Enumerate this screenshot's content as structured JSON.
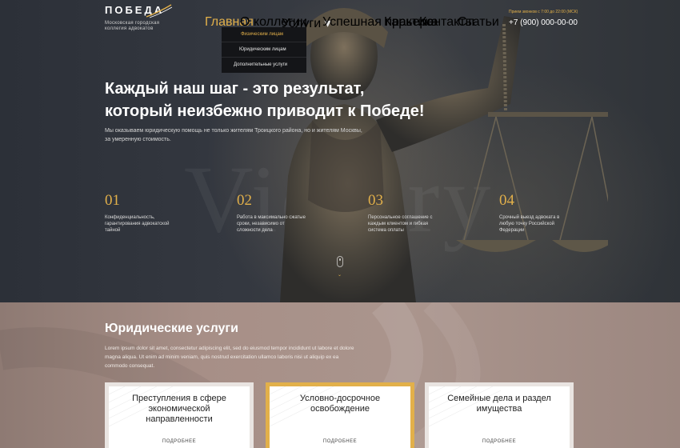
{
  "header": {
    "logo_name": "ПОБЕДА",
    "logo_sub_line1": "Московская городская",
    "logo_sub_line2": "коллегия адвокатов",
    "phone_note": "Прием звонков с 7:00 до 22:00 (МСК)",
    "phone": "+7 (900) 000-00-00",
    "nav": [
      "Главная",
      "О коллегии",
      "Услуги",
      "Успешная практика",
      "Карьера",
      "Контакты",
      "Статьи"
    ],
    "services_chevron": "▾"
  },
  "dropdown": [
    "Физическим лицам",
    "Юридическим лицам",
    "Дополнительные услуги"
  ],
  "hero": {
    "title_line1": "Каждый наш шаг - это результат,",
    "title_line2": "который неизбежно приводит к Победе!",
    "subtitle_line1": "Мы оказываем юридическую помощь не только жителям Троицкого района, но и жителям Москвы,",
    "subtitle_line2": "за умеренную стоимость.",
    "watermark": "Victory",
    "scroll_arrow": "⌄"
  },
  "features": [
    {
      "num": "01",
      "line1": "Конфиденциальность,",
      "line2": "гарантирования адвокатской",
      "line3": "тайной"
    },
    {
      "num": "02",
      "line1": "Работа в максимально сжатые",
      "line2": "сроки, независимо от",
      "line3": "сложности дела"
    },
    {
      "num": "03",
      "line1": "Персональное соглашение с",
      "line2": "каждым клиентом и гибкая",
      "line3": "система оплаты"
    },
    {
      "num": "04",
      "line1": "Срочный выезд адвоката в",
      "line2": "любую точку Российской",
      "line3": "Федерации"
    }
  ],
  "services": {
    "title": "Юридические услуги",
    "text_line1": "Lorem ipsum dolor sit amet, consectetur adipiscing elit, sed do eiusmod tempor incididunt ut labore et dolore",
    "text_line2": "magna aliqua. Ut enim ad minim veniam, quis nostrud exercitation ullamco laboris nisi ut aliquip ex ea",
    "text_line3": "commodo consequat.",
    "cards": [
      {
        "title": "Преступления в сфере экономической направленности",
        "more": "ПОДРОБНЕЕ"
      },
      {
        "title": "Условно-досрочное освобождение",
        "more": "ПОДРОБНЕЕ"
      },
      {
        "title": "Семейные дела и раздел имущества",
        "more": "ПОДРОБНЕЕ"
      }
    ]
  },
  "colors": {
    "accent": "#e2b04a",
    "dark": "#141518"
  }
}
